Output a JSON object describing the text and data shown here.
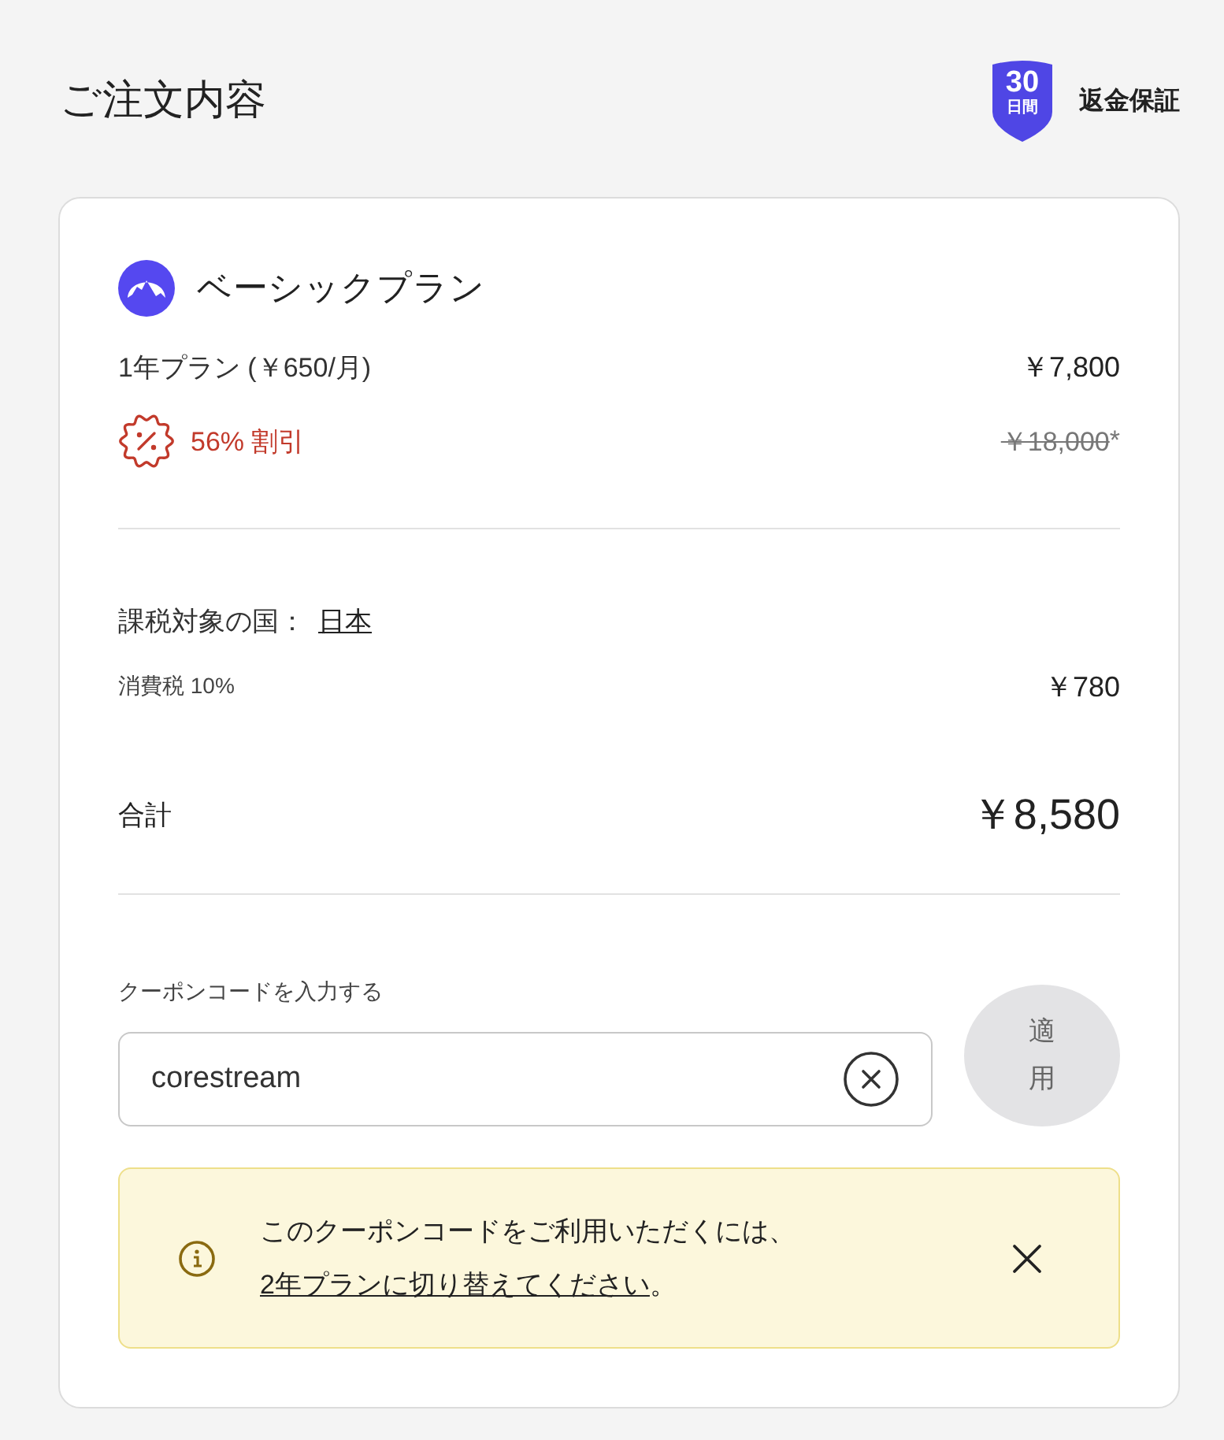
{
  "header": {
    "title": "ご注文内容",
    "badge": {
      "number": "30",
      "unit": "日間"
    },
    "badge_label": "返金保証"
  },
  "plan": {
    "name": "ベーシックプラン",
    "term": "1年プラン (￥650/月)",
    "price": "￥7,800",
    "discount": "56% 割引",
    "original_price": "￥18,000",
    "original_price_note": "*"
  },
  "tax": {
    "country_label": "課税対象の国：",
    "country": "日本",
    "tax_label": "消費税 10%",
    "tax_amount": "￥780"
  },
  "total": {
    "label": "合計",
    "amount": "￥8,580"
  },
  "coupon": {
    "label": "クーポンコードを入力する",
    "value": "corestream",
    "apply_button": {
      "label": "適用",
      "disabled": true
    }
  },
  "alert": {
    "text": "このクーポンコードをご利用いただくには、",
    "link": "2年プランに切り替えてください",
    "text_end": "。"
  }
}
